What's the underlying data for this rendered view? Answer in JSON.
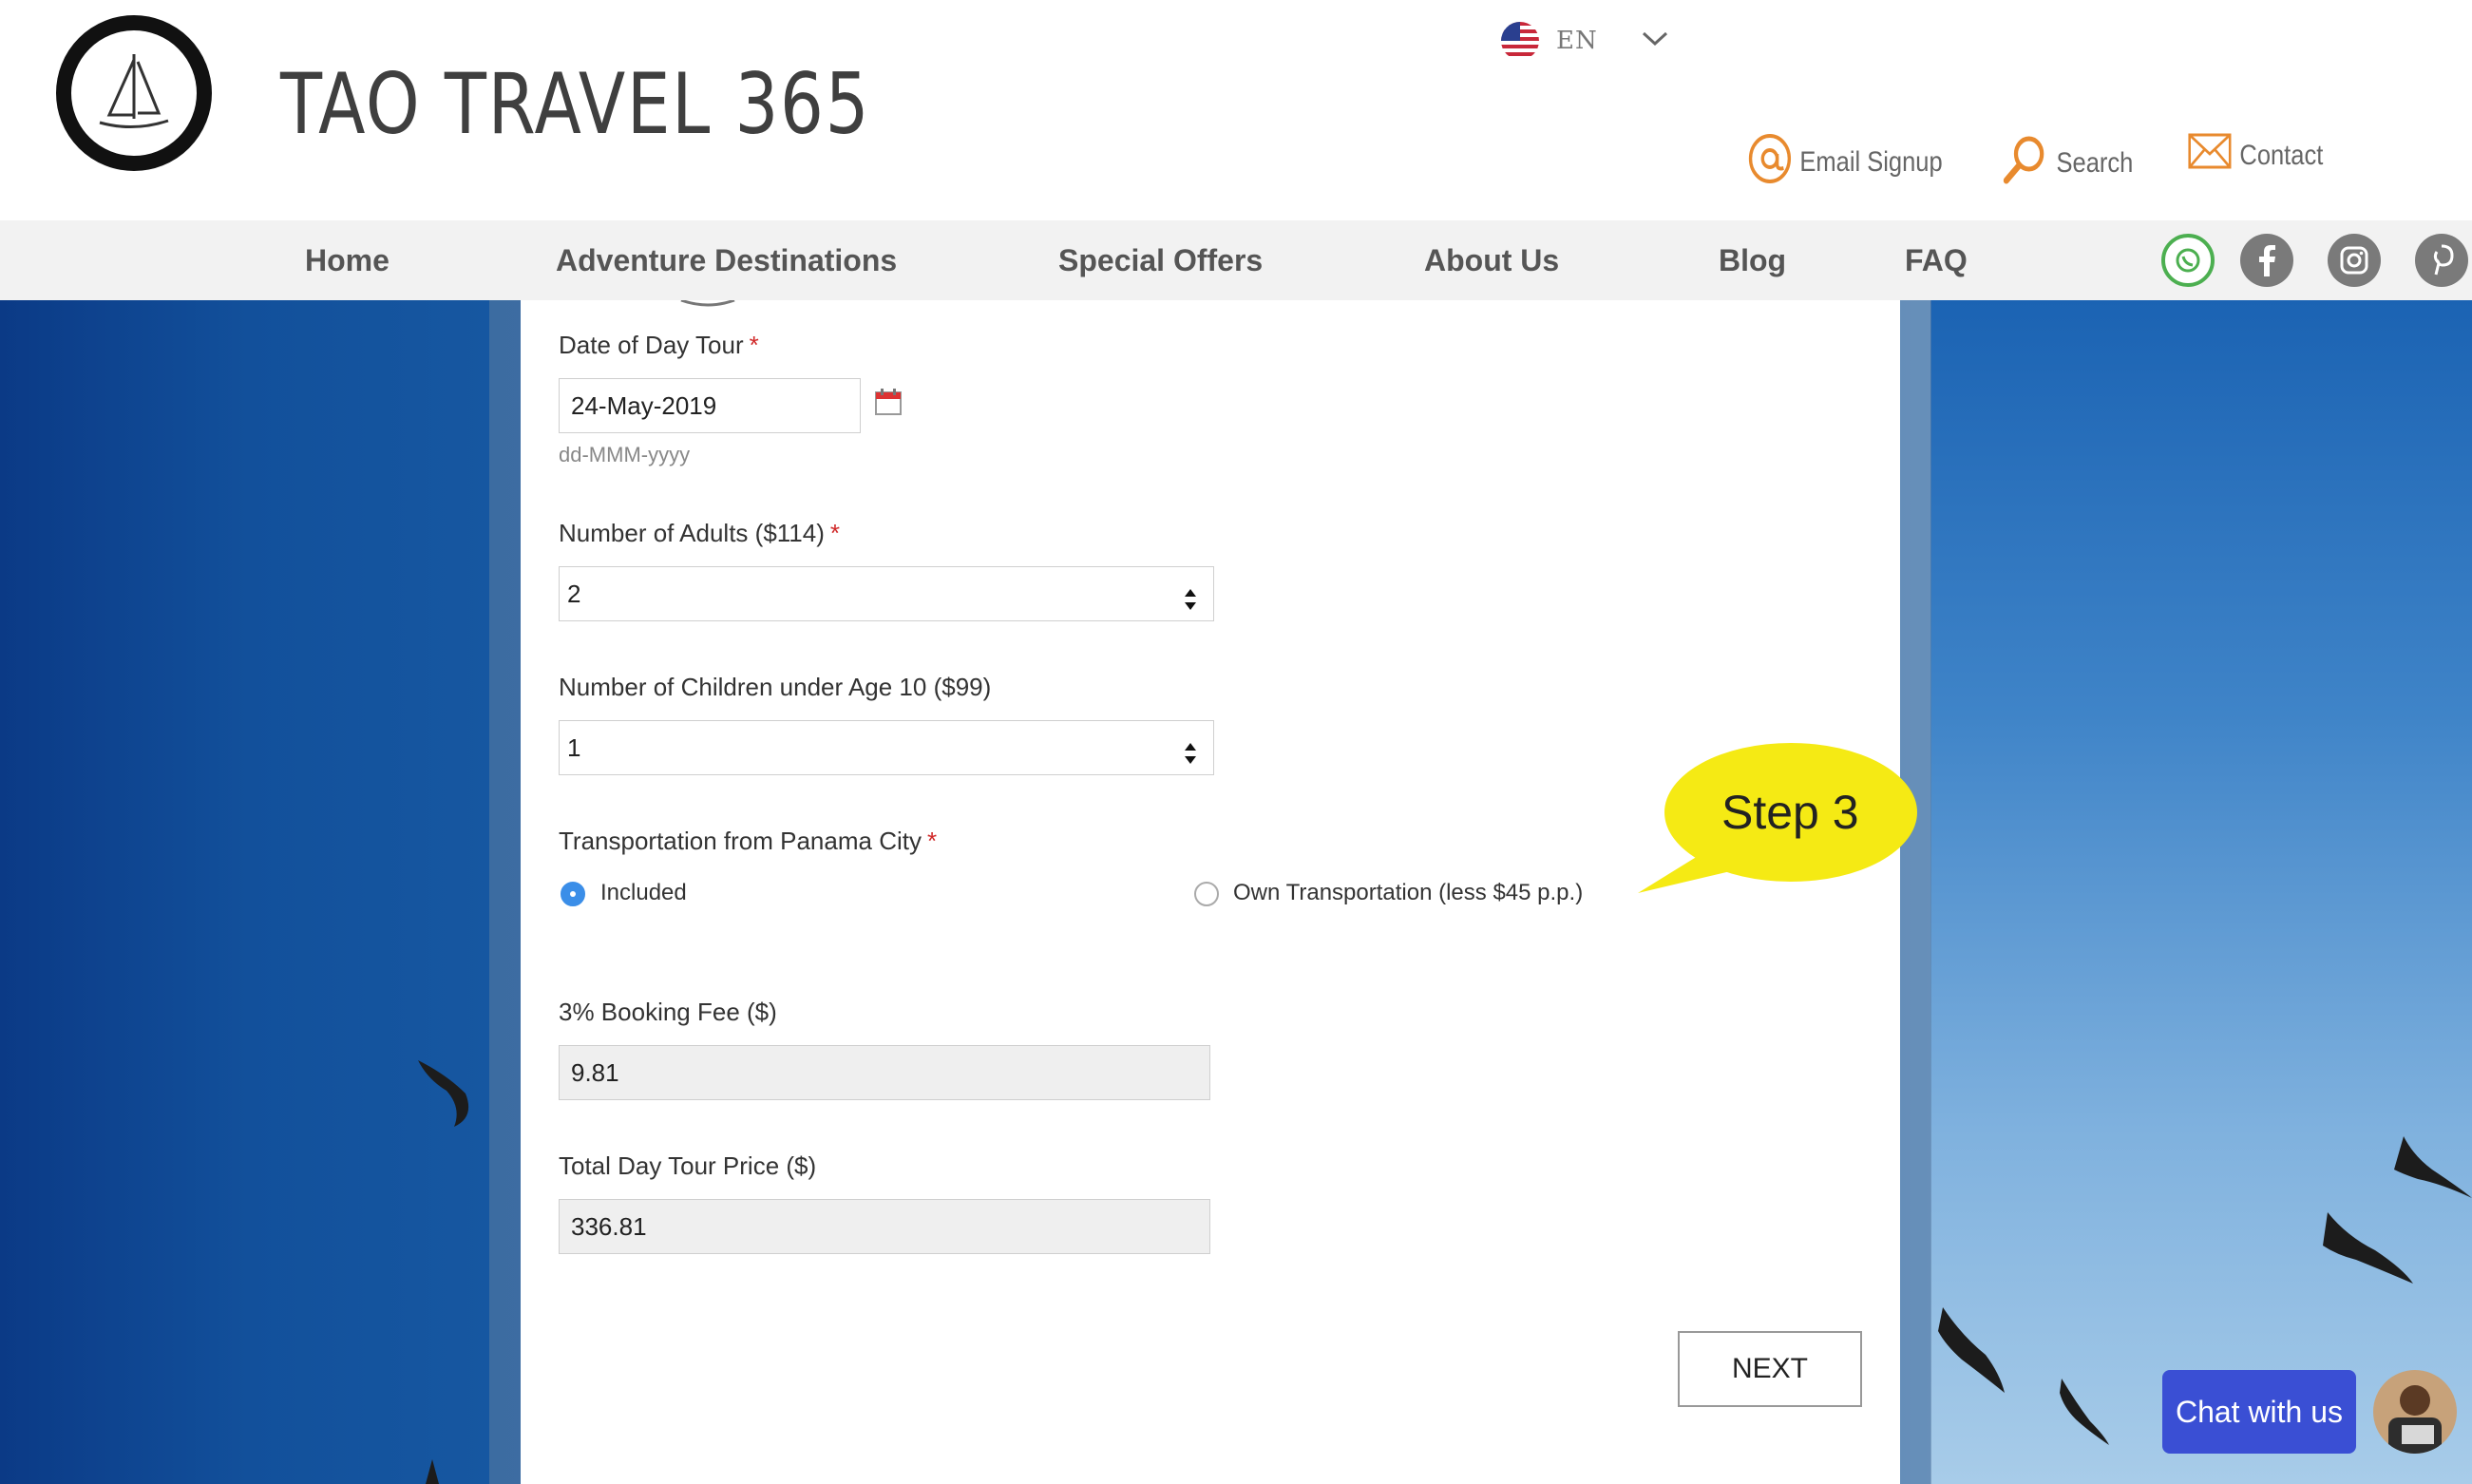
{
  "brand": {
    "name": "TAO TRAVEL 365"
  },
  "language": {
    "code": "EN"
  },
  "utility_links": [
    {
      "label": "Email Signup",
      "icon": "at-icon"
    },
    {
      "label": "Search",
      "icon": "magnifier-icon"
    },
    {
      "label": "Contact",
      "icon": "envelope-icon"
    }
  ],
  "nav": [
    {
      "label": "Home"
    },
    {
      "label": "Adventure Destinations"
    },
    {
      "label": "Special Offers"
    },
    {
      "label": "About Us"
    },
    {
      "label": "Blog"
    },
    {
      "label": "FAQ"
    }
  ],
  "social": [
    "whatsapp-icon",
    "facebook-icon",
    "instagram-icon",
    "pinterest-icon"
  ],
  "form": {
    "date": {
      "label": "Date of Day Tour",
      "required": "*",
      "value": "24-May-2019",
      "hint": "dd-MMM-yyyy"
    },
    "adults": {
      "label": "Number of Adults ($114)",
      "required": "*",
      "value": "2"
    },
    "children": {
      "label": "Number of Children under Age 10 ($99)",
      "value": "1"
    },
    "transport": {
      "label": "Transportation from Panama City",
      "required": "*",
      "options": [
        {
          "label": "Included",
          "selected": true
        },
        {
          "label": "Own Transportation (less $45 p.p.)",
          "selected": false
        }
      ]
    },
    "fee": {
      "label": "3% Booking Fee ($)",
      "value": "9.81"
    },
    "total": {
      "label": "Total Day Tour Price ($)",
      "value": "336.81"
    },
    "next_label": "NEXT"
  },
  "callout": {
    "text": "Step 3",
    "color": "#f5ea14"
  },
  "chat": {
    "label": "Chat with us"
  },
  "colors": {
    "accent_orange": "#e88a2e",
    "chat_blue": "#3a4fd4",
    "radio_blue": "#3b8ee8",
    "required_red": "#d02828"
  }
}
